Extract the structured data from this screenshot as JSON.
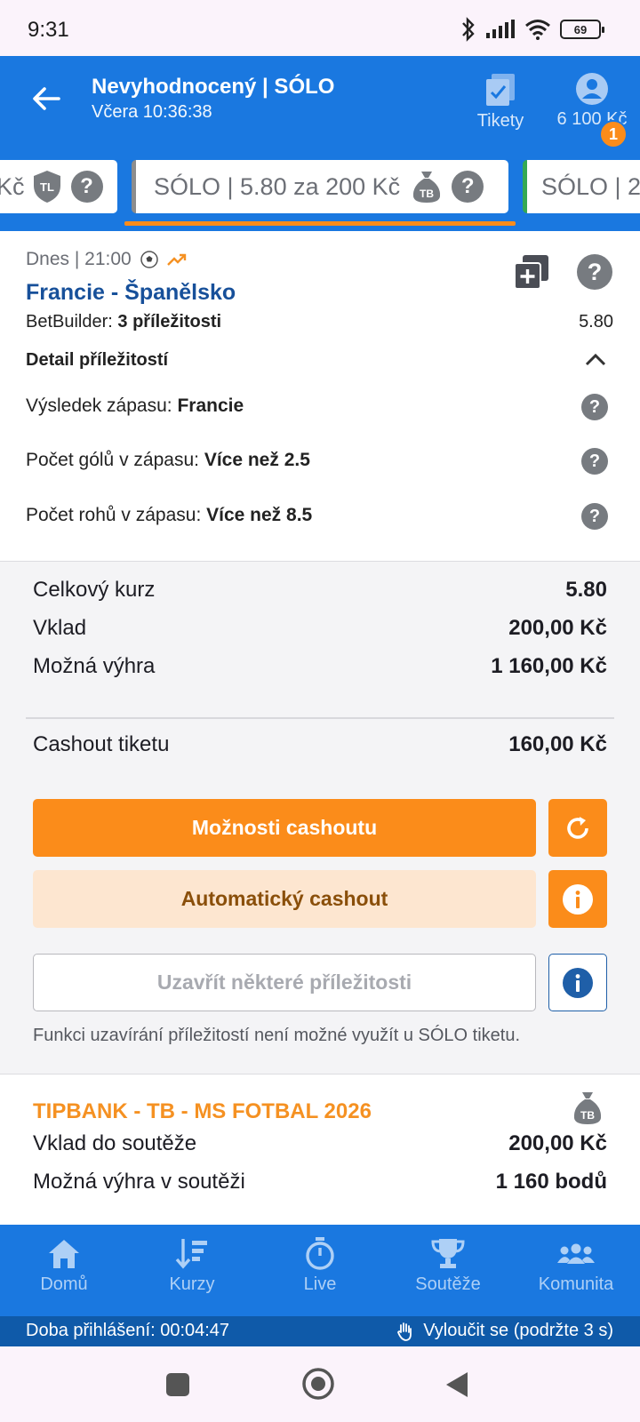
{
  "status_bar": {
    "time": "9:31",
    "battery": "69"
  },
  "header": {
    "title": "Nevyhodnocený | SÓLO",
    "subtitle": "Včera 10:36:38",
    "tikety_label": "Tikety",
    "balance": "6 100 Kč",
    "notification_count": "1"
  },
  "tabs": {
    "left_label": "Kč",
    "center_label": "SÓLO  | 5.80 za 200 Kč",
    "right_label": "SÓLO  | 2"
  },
  "event": {
    "date": "Dnes  | 21:00",
    "teams": "Francie - Španělsko",
    "betbuilder_prefix": "BetBuilder:",
    "betbuilder_value": "3 příležitosti",
    "odd": "5.80",
    "detail_label": "Detail příležitostí",
    "selections": [
      {
        "label": "Výsledek zápasu:",
        "value": "Francie"
      },
      {
        "label": "Počet gólů v zápasu:",
        "value": "Více než 2.5"
      },
      {
        "label": "Počet rohů v zápasu:",
        "value": "Více než 8.5"
      }
    ]
  },
  "summary": {
    "total_odd_label": "Celkový kurz",
    "total_odd_value": "5.80",
    "stake_label": "Vklad",
    "stake_value": "200,00 Kč",
    "win_label": "Možná výhra",
    "win_value": "1 160,00 Kč",
    "cashout_label": "Cashout tiketu",
    "cashout_value": "160,00 Kč",
    "cashout_options_button": "Možnosti cashoutu",
    "auto_cashout_button": "Automatický cashout",
    "close_some_button": "Uzavřít některé příležitosti",
    "note": "Funkci uzavírání příležitostí není možné využít u SÓLO tiketu."
  },
  "tipbank": {
    "title": "TIPBANK - TB - MS FOTBAL 2026",
    "stake_label": "Vklad do soutěže",
    "stake_value": "200,00 Kč",
    "win_label": "Možná výhra v soutěži",
    "win_value": "1 160 bodů"
  },
  "bottom_nav": {
    "items": [
      {
        "label": "Domů",
        "icon": "home-icon"
      },
      {
        "label": "Kurzy",
        "icon": "odds-icon"
      },
      {
        "label": "Live",
        "icon": "stopwatch-icon"
      },
      {
        "label": "Soutěže",
        "icon": "trophy-icon"
      },
      {
        "label": "Komunita",
        "icon": "community-icon"
      }
    ]
  },
  "session": {
    "login_time": "Doba přihlášení: 00:04:47",
    "exclude": "Vyloučit se (podržte 3 s)"
  },
  "colors": {
    "brand_blue": "#1a78e0",
    "accent_orange": "#fb8c1a",
    "team_blue": "#17509a"
  }
}
